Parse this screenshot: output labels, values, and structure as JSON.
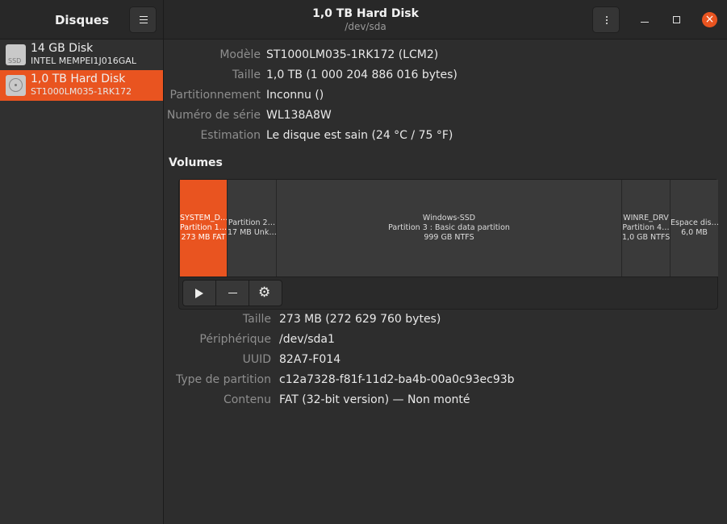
{
  "sidebar": {
    "title": "Disques",
    "disks": [
      {
        "name": "14 GB Disk",
        "model": "INTEL MEMPEI1J016GAL",
        "icon": "ssd-icon",
        "icon_label": "SSD",
        "selected": false
      },
      {
        "name": "1,0 TB Hard Disk",
        "model": "ST1000LM035-1RK172",
        "icon": "hard-disk-icon",
        "selected": true
      }
    ]
  },
  "header": {
    "title": "1,0 TB Hard Disk",
    "subtitle": "/dev/sda"
  },
  "disk_info": {
    "rows": [
      {
        "label": "Modèle",
        "value": "ST1000LM035-1RK172 (LCM2)"
      },
      {
        "label": "Taille",
        "value": "1,0 TB (1 000 204 886 016 bytes)"
      },
      {
        "label": "Partitionnement",
        "value": "Inconnu ()"
      },
      {
        "label": "Numéro de série",
        "value": "WL138A8W"
      },
      {
        "label": "Estimation",
        "value": "Le disque est sain (24 °C / 75 °F)"
      }
    ]
  },
  "volumes": {
    "title": "Volumes",
    "segments": [
      {
        "line1": "SYSTEM_D…",
        "line2": "Partition 1…",
        "line3": "273 MB FAT",
        "selected": true
      },
      {
        "line1": "",
        "line2": "Partition 2…",
        "line3": "17 MB Unk…",
        "selected": false
      },
      {
        "line1": "Windows-SSD",
        "line2": "Partition 3 : Basic data partition",
        "line3": "999 GB NTFS",
        "selected": false
      },
      {
        "line1": "WINRE_DRV",
        "line2": "Partition 4…",
        "line3": "1,0 GB NTFS",
        "selected": false
      },
      {
        "line1": "",
        "line2": "Espace dis…",
        "line3": "6,0 MB",
        "selected": false
      }
    ]
  },
  "partition_info": {
    "rows": [
      {
        "label": "Taille",
        "value": "273 MB (272 629 760 bytes)"
      },
      {
        "label": "Périphérique",
        "value": "/dev/sda1"
      },
      {
        "label": "UUID",
        "value": "82A7-F014"
      },
      {
        "label": "Type de partition",
        "value": "c12a7328-f81f-11d2-ba4b-00a0c93ec93b"
      },
      {
        "label": "Contenu",
        "value": "FAT (32-bit version) — Non monté"
      }
    ]
  },
  "colors": {
    "accent": "#e95420",
    "background": "#2d2d2d"
  }
}
